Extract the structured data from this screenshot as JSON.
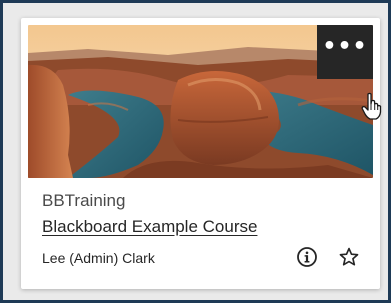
{
  "card": {
    "organization": "BBTraining",
    "course_title": "Blackboard Example Course",
    "instructor": "Lee (Admin) Clark",
    "menu_label": "•••",
    "banner_image": "canyon-river-bend",
    "icons": {
      "info": "info-icon",
      "favorite": "star-outline-icon",
      "menu": "more-options-icon",
      "cursor": "hand-cursor-icon"
    }
  },
  "colors": {
    "frame_border": "#1e3a56",
    "menu_button_bg": "#262626",
    "text_primary": "#262626",
    "text_secondary": "#4a4a4a"
  }
}
